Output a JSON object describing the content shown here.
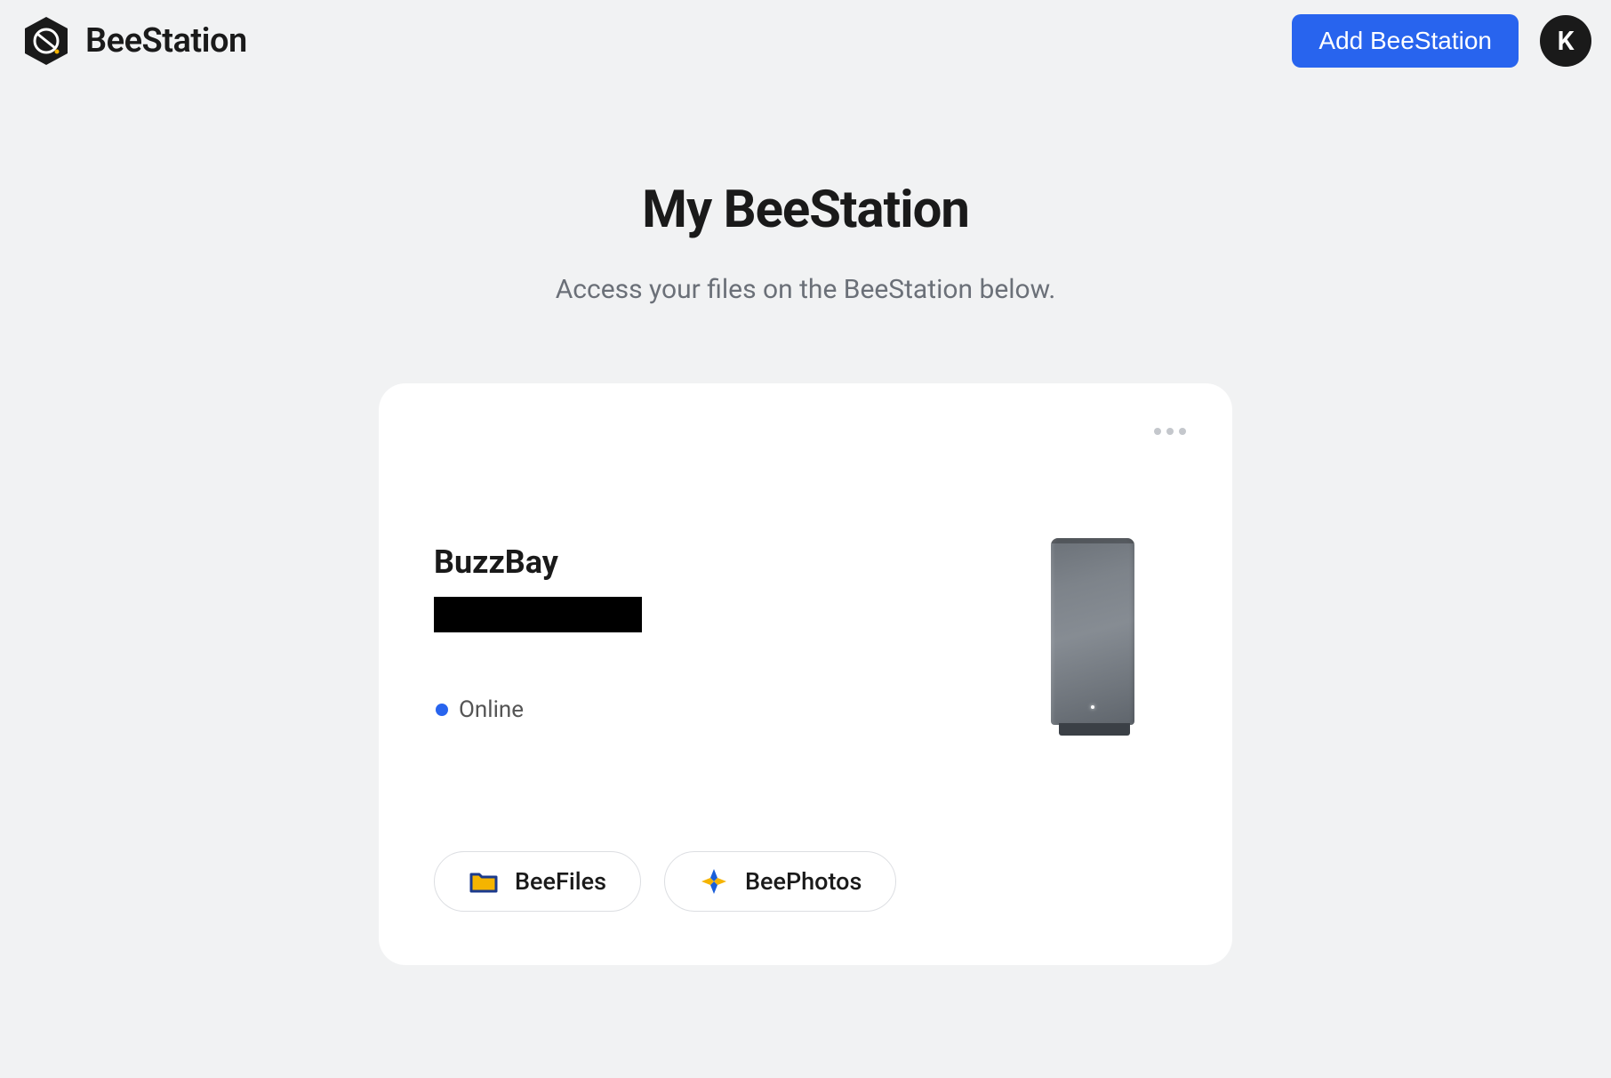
{
  "header": {
    "brand_name": "BeeStation",
    "add_button_label": "Add BeeStation",
    "avatar_initial": "K"
  },
  "main": {
    "title": "My BeeStation",
    "subtitle": "Access your files on the BeeStation below."
  },
  "device": {
    "name": "BuzzBay",
    "status_label": "Online",
    "apps": [
      {
        "label": "BeeFiles"
      },
      {
        "label": "BeePhotos"
      }
    ]
  }
}
